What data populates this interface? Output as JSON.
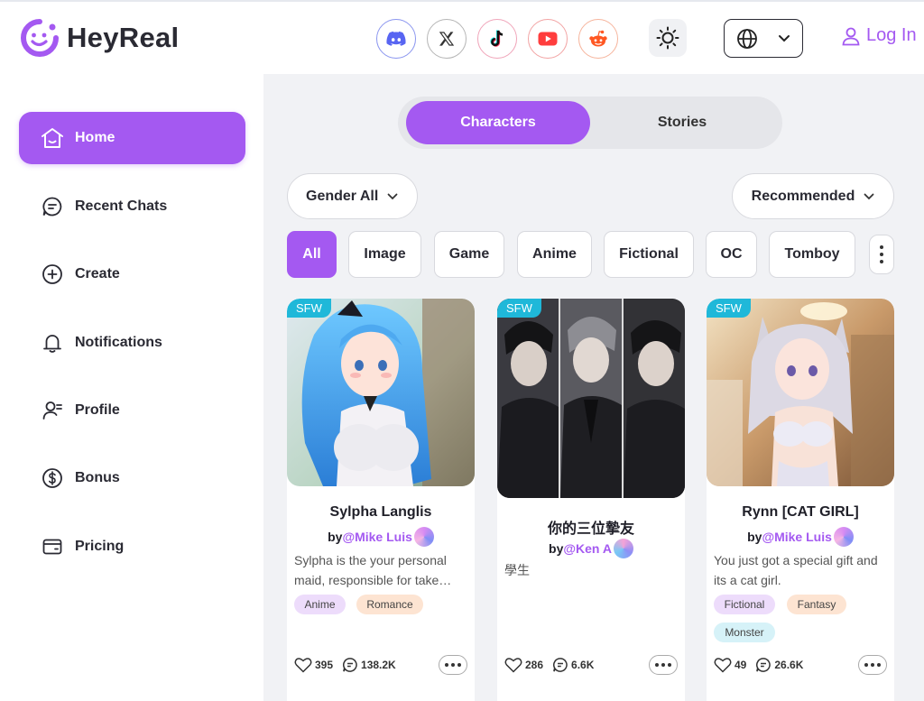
{
  "brand": {
    "name": "HeyReal",
    "accent": "#a459f1"
  },
  "header": {
    "social": [
      {
        "name": "discord-icon",
        "color": "#5865f2"
      },
      {
        "name": "x-icon",
        "color": "#333333"
      },
      {
        "name": "tiktok-icon",
        "color": "#111111"
      },
      {
        "name": "youtube-icon",
        "color": "#ff3d3d"
      },
      {
        "name": "reddit-icon",
        "color": "#ff5722"
      }
    ],
    "theme_icon": "sun-icon",
    "language_icon": "globe-icon",
    "login_label": "Log In"
  },
  "sidebar": {
    "items": [
      {
        "label": "Home",
        "icon": "home-icon",
        "active": true
      },
      {
        "label": "Recent Chats",
        "icon": "chat-icon"
      },
      {
        "label": "Create",
        "icon": "plus-circle-icon"
      },
      {
        "label": "Notifications",
        "icon": "bell-icon"
      },
      {
        "label": "Profile",
        "icon": "user-icon"
      },
      {
        "label": "Bonus",
        "icon": "dollar-icon"
      },
      {
        "label": "Pricing",
        "icon": "wallet-icon"
      }
    ]
  },
  "main": {
    "tabs": [
      {
        "label": "Characters",
        "active": true
      },
      {
        "label": "Stories"
      }
    ],
    "filters": {
      "gender": "Gender All",
      "sort": "Recommended"
    },
    "chips": [
      "All",
      "Image",
      "Game",
      "Anime",
      "Fictional",
      "OC",
      "Tomboy"
    ],
    "cards": [
      {
        "badge": "SFW",
        "title": "Sylpha Langlis",
        "by": "by",
        "author": "@Mike Luis",
        "description": "Sylpha is the your personal maid, responsible for take…",
        "tags": [
          "Anime",
          "Romance"
        ],
        "likes": "395",
        "chats": "138.2K"
      },
      {
        "badge": "SFW",
        "title": "你的三位摯友",
        "by": "by",
        "author": "@Ken A",
        "description": "學生",
        "tags": [],
        "likes": "286",
        "chats": "6.6K"
      },
      {
        "badge": "SFW",
        "title": "Rynn [CAT GIRL]",
        "by": "by",
        "author": "@Mike Luis",
        "description": "You just got a special gift and its a cat girl.",
        "tags": [
          "Fictional",
          "Fantasy",
          "Monster"
        ],
        "likes": "49",
        "chats": "26.6K"
      }
    ]
  }
}
